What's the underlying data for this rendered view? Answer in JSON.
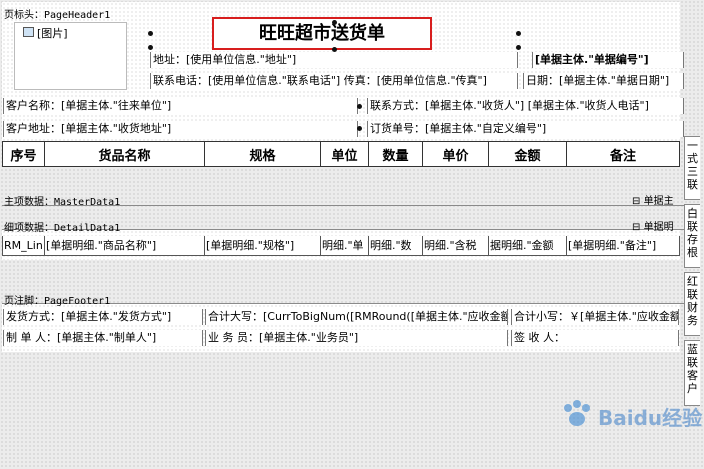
{
  "bands": {
    "page_header": "页标头：PageHeader1",
    "master": "主项数据：MasterData1",
    "detail": "细项数据：DetailData1",
    "page_footer": "页注脚：PageFooter1"
  },
  "header": {
    "image_label": "[图片]",
    "title": "旺旺超市送货单",
    "address": "地址：[使用单位信息.\"地址\"]",
    "contact": "联系电话：[使用单位信息.\"联系电话\"] 传真：[使用单位信息.\"传真\"]",
    "bill_no": "[单据主体.\"单据编号\"]",
    "date": "日期：[单据主体.\"单据日期\"]",
    "customer_name": "客户名称：[单据主体.\"往来单位\"]",
    "contact_person": "联系方式：[单据主体.\"收货人\"] [单据主体.\"收货人电话\"]",
    "customer_address": "客户地址：[单据主体.\"收货地址\"]",
    "order_no": "订货单号：[单据主体.\"自定义编号\"]"
  },
  "table": {
    "columns": [
      "序号",
      "货品名称",
      "规格",
      "单位",
      "数量",
      "单价",
      "金额",
      "备注"
    ]
  },
  "master": {
    "right_label": "单据主"
  },
  "detail": {
    "right_label": "单据明",
    "cells": [
      "RM_Lin",
      "[单据明细.\"商品名称\"]",
      "[单据明细.\"规格\"]",
      "明细.\"单",
      "明细.\"数",
      "明细.\"含税",
      "据明细.\"金额",
      "[单据明细.\"备注\"]"
    ]
  },
  "footer": {
    "ship_method": "发货方式：[单据主体.\"发货方式\"]",
    "total_upper": "合计大写：[CurrToBigNum([RMRound([单据主体.\"应收金额\"]",
    "total_lower": "合计小写：￥[单据主体.\"应收金额\"]",
    "maker": "制 单 人：[单据主体.\"制单人\"]",
    "salesman": "业 务 员：[单据主体.\"业务员\"]",
    "receiver": "签 收 人："
  },
  "side_tabs": [
    "一式三联",
    "白联存根",
    "红联财务",
    "蓝联客户"
  ],
  "watermark": "Baidu经验",
  "colors": {
    "title_border": "#d81e1e",
    "canvas_bg": "#ececec"
  }
}
